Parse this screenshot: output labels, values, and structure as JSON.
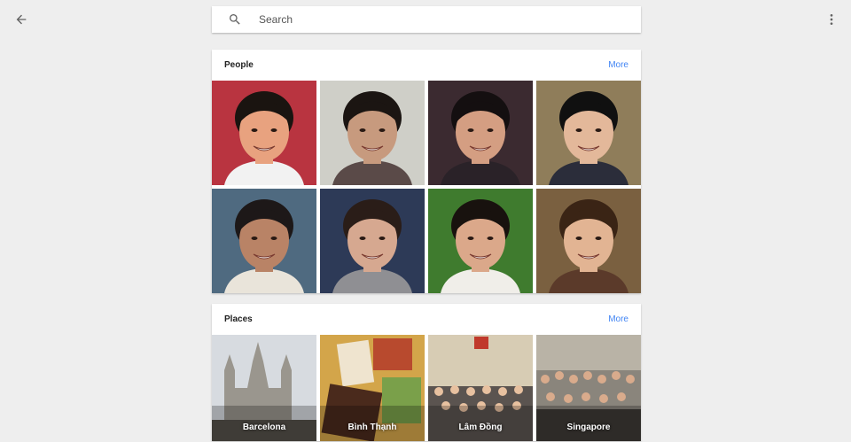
{
  "search": {
    "placeholder": "Search"
  },
  "people": {
    "title": "People",
    "more_label": "More",
    "faces": [
      {
        "bg": "#b93440",
        "skin": "#e8a27f",
        "hair": "#1a1410",
        "shirt": "#f2f2f2"
      },
      {
        "bg": "#cfcfc8",
        "skin": "#c79a7e",
        "hair": "#1b1512",
        "shirt": "#5a4a48"
      },
      {
        "bg": "#3b2a30",
        "skin": "#d49e82",
        "hair": "#140f10",
        "shirt": "#2a2228"
      },
      {
        "bg": "#8f7d5a",
        "skin": "#e3b89a",
        "hair": "#101010",
        "shirt": "#2b2d3a"
      },
      {
        "bg": "#4f6a80",
        "skin": "#b98366",
        "hair": "#1d1818",
        "shirt": "#e9e4da"
      },
      {
        "bg": "#2d3a57",
        "skin": "#d6a890",
        "hair": "#2a1d18",
        "shirt": "#8f8f93"
      },
      {
        "bg": "#3f7b2e",
        "skin": "#dba88a",
        "hair": "#18120e",
        "shirt": "#f0eee9"
      },
      {
        "bg": "#7a6040",
        "skin": "#e2b493",
        "hair": "#3a2415",
        "shirt": "#5b3a2a"
      }
    ]
  },
  "places": {
    "title": "Places",
    "more_label": "More",
    "items": [
      {
        "label": "Barcelona",
        "bg": "#c6c9ce"
      },
      {
        "label": "Bình Thạnh",
        "bg": "#c69a3e"
      },
      {
        "label": "Lâm Đồng",
        "bg": "#cbbfa7"
      },
      {
        "label": "Singapore",
        "bg": "#6e6a63"
      }
    ]
  }
}
